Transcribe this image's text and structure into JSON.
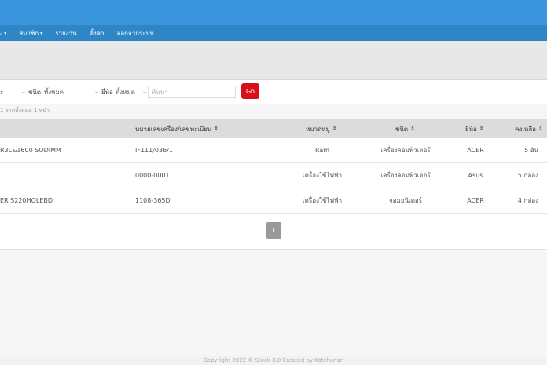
{
  "nav": {
    "items": [
      {
        "label": "ม",
        "caret": true
      },
      {
        "label": "สมาชิก",
        "caret": true
      },
      {
        "label": "รายงาน",
        "caret": false
      },
      {
        "label": "ตั้งค่า",
        "caret": false
      },
      {
        "label": "ออกจากระบบ",
        "caret": false
      }
    ]
  },
  "filters": {
    "first_select_value": "ะ",
    "type_label": "ชนิด",
    "type_value": "ทั้งหมด",
    "brand_label": "ยี่ห้อ",
    "brand_value": "ทั้งหมด",
    "search_placeholder": "ค้นหา",
    "go_label": "Go"
  },
  "summary_text": "1 จากทั้งหมด 1 หน้า",
  "table": {
    "headers": {
      "serial": "หมายเลขเครื่อง/เลขทะเบียน",
      "category": "หมวดหมู่",
      "type": "ชนิด",
      "brand": "ยี่ห้อ",
      "remaining": "คงเหลือ"
    },
    "sort_icon": "⇕",
    "rows": [
      {
        "name": "R3L&1600 SODIMM",
        "serial": "IF111/036/1",
        "category": "Ram",
        "type": "เครื่องคอมพิวเตอร์",
        "brand": "ACER",
        "remaining": "5 อัน"
      },
      {
        "name": "",
        "serial": "0000-0001",
        "category": "เครื่องใช้ไฟฟ้า",
        "type": "เครื่องคอมพิวเตอร์",
        "brand": "Asus",
        "remaining": "5 กล่อง"
      },
      {
        "name": "ER S220HQLEBD",
        "serial": "1108-365D",
        "category": "เครื่องใช้ไฟฟ้า",
        "type": "จอมอนิเตอร์",
        "brand": "ACER",
        "remaining": "4 กล่อง"
      }
    ]
  },
  "pagination": {
    "current": "1"
  },
  "footer": "Copyright 2022 © Stock 8.0 Created by Kotchanan",
  "colors": {
    "topbar": "#3a95dc",
    "navbar": "#2f86c7",
    "go_button": "#d9101a"
  }
}
